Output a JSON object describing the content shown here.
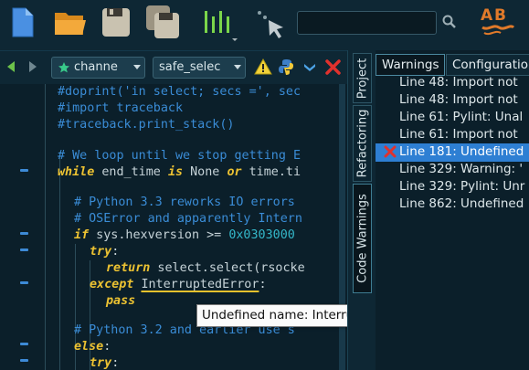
{
  "toolbar": {
    "search_value": "",
    "search_placeholder": ""
  },
  "editor": {
    "back_label": "back",
    "forward_label": "forward",
    "class_combo": "channe",
    "method_combo": "safe_selec",
    "tooltip": "Undefined name: InterruptedError",
    "code": {
      "l1_comment": "#doprint('in select; secs =', sec",
      "l2_comment": "#import traceback",
      "l3_comment": "#traceback.print_stack()",
      "l4_comment": "# We loop until we stop getting E",
      "l5_while": "while",
      "l5_a": " end_time ",
      "l5_is": "is",
      "l5_none": " None ",
      "l5_or": "or",
      "l5_b": " time.ti",
      "l6_comment": "# Python 3.3 reworks IO errors",
      "l7_comment": "# OSError and apparently Intern",
      "l8_if": "if",
      "l8_a": " sys.hexversion >= ",
      "l8_num": "0x0303000",
      "l9_try": "try",
      "l9_colon": ":",
      "l10_return": "return",
      "l10_rest": " select.select(rsocke",
      "l11_except": "except",
      "l11_space": " ",
      "l11_name": "InterruptedError",
      "l11_colon": ":",
      "l12_pass": "pass",
      "l13_comment": "# Python 3.2 and earlier use s",
      "l14_else": "else",
      "l14_colon": ":",
      "l15_try": "try",
      "l15_colon": ":"
    }
  },
  "side_tabs": {
    "project": "Project",
    "refactoring": "Refactoring",
    "code_warnings": "Code Warnings"
  },
  "panel": {
    "tabs": [
      "Warnings",
      "Configuration"
    ],
    "warnings": [
      "Line 48: Import not",
      "Line 48: Import not",
      "Line 61: Pylint: Unal",
      "Line 61: Import not",
      "Line 181: Undefined",
      "Line 329: Warning: '",
      "Line 329: Pylint: Unr",
      "Line 862: Undefined"
    ],
    "selected_index": 4
  },
  "colors": {
    "background": "#0b1f2a",
    "comment": "#3a8cd6",
    "keyword": "#ecc232",
    "selection": "#2e7fd3"
  }
}
